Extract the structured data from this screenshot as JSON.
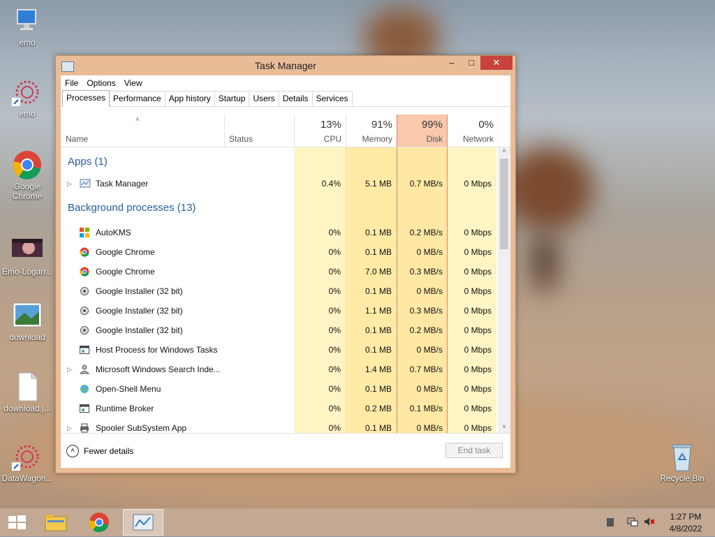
{
  "desktop": {
    "icons": [
      {
        "label": "emo"
      },
      {
        "label": "emo"
      },
      {
        "label": "Google Chrome"
      },
      {
        "label": "Emo-Logan..."
      },
      {
        "label": "download"
      },
      {
        "label": "download.j..."
      },
      {
        "label": "DataWagon..."
      },
      {
        "label": "Recycle Bin"
      }
    ]
  },
  "window": {
    "title": "Task Manager",
    "minimize": "–",
    "maximize": "□",
    "close": "✕",
    "menu": [
      "File",
      "Options",
      "View"
    ],
    "tabs": [
      "Processes",
      "Performance",
      "App history",
      "Startup",
      "Users",
      "Details",
      "Services"
    ],
    "active_tab": "Processes",
    "columns": {
      "name": "Name",
      "status": "Status",
      "cpu": {
        "pct": "13%",
        "label": "CPU"
      },
      "memory": {
        "pct": "91%",
        "label": "Memory"
      },
      "disk": {
        "pct": "99%",
        "label": "Disk"
      },
      "network": {
        "pct": "0%",
        "label": "Network"
      }
    },
    "groups": {
      "apps": "Apps (1)",
      "background": "Background processes (13)"
    },
    "apps": [
      {
        "name": "Task Manager",
        "cpu": "0.4%",
        "memory": "5.1 MB",
        "disk": "0.7 MB/s",
        "network": "0 Mbps"
      }
    ],
    "processes": [
      {
        "name": "AutoKMS",
        "cpu": "0%",
        "memory": "0.1 MB",
        "disk": "0.2 MB/s",
        "network": "0 Mbps"
      },
      {
        "name": "Google Chrome",
        "cpu": "0%",
        "memory": "0.1 MB",
        "disk": "0 MB/s",
        "network": "0 Mbps"
      },
      {
        "name": "Google Chrome",
        "cpu": "0%",
        "memory": "7.0 MB",
        "disk": "0.3 MB/s",
        "network": "0 Mbps"
      },
      {
        "name": "Google Installer (32 bit)",
        "cpu": "0%",
        "memory": "0.1 MB",
        "disk": "0 MB/s",
        "network": "0 Mbps"
      },
      {
        "name": "Google Installer (32 bit)",
        "cpu": "0%",
        "memory": "1.1 MB",
        "disk": "0.3 MB/s",
        "network": "0 Mbps"
      },
      {
        "name": "Google Installer (32 bit)",
        "cpu": "0%",
        "memory": "0.1 MB",
        "disk": "0.2 MB/s",
        "network": "0 Mbps"
      },
      {
        "name": "Host Process for Windows Tasks",
        "cpu": "0%",
        "memory": "0.1 MB",
        "disk": "0 MB/s",
        "network": "0 Mbps"
      },
      {
        "name": "Microsoft Windows Search Inde...",
        "cpu": "0%",
        "memory": "1.4 MB",
        "disk": "0.7 MB/s",
        "network": "0 Mbps"
      },
      {
        "name": "Open-Shell Menu",
        "cpu": "0%",
        "memory": "0.1 MB",
        "disk": "0 MB/s",
        "network": "0 Mbps"
      },
      {
        "name": "Runtime Broker",
        "cpu": "0%",
        "memory": "0.2 MB",
        "disk": "0.1 MB/s",
        "network": "0 Mbps"
      },
      {
        "name": "Spooler SubSystem App",
        "cpu": "0%",
        "memory": "0.1 MB",
        "disk": "0 MB/s",
        "network": "0 Mbps"
      }
    ],
    "fewer_details": "Fewer details",
    "end_task": "End task",
    "colors": {
      "cpu": "#fff4c4",
      "memory": "#ffeaa6",
      "disk": "#ffe8a3",
      "disk_header": "#f9c8ad",
      "group": "#2a5d9f"
    }
  },
  "taskbar": {
    "time": "1:27 PM",
    "date": "4/8/2022"
  }
}
